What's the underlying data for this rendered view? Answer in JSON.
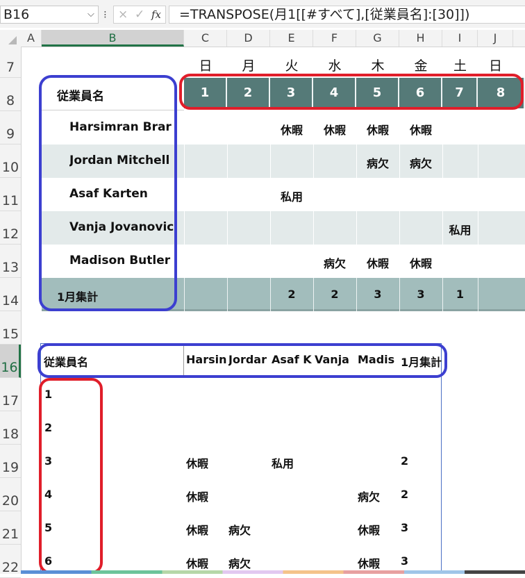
{
  "formula_bar": {
    "cell_ref": "B16",
    "formula": "=TRANSPOSE(月1[[#すべて],[従業員名]:[30]])",
    "fx_label": "fx",
    "cancel_icon": "×",
    "enter_icon": "✓"
  },
  "columns": [
    "A",
    "B",
    "C",
    "D",
    "E",
    "F",
    "G",
    "H",
    "I",
    "J"
  ],
  "rows": [
    "7",
    "8",
    "9",
    "10",
    "11",
    "12",
    "13",
    "14",
    "15",
    "16",
    "17",
    "18",
    "19",
    "20",
    "21",
    "22"
  ],
  "schedule": {
    "weekdays": [
      "日",
      "月",
      "火",
      "水",
      "木",
      "金",
      "土",
      "日"
    ],
    "header_label": "従業員名",
    "days": [
      "1",
      "2",
      "3",
      "4",
      "5",
      "6",
      "7",
      "8"
    ],
    "employees": [
      {
        "name": "Harsimran Brar",
        "marks": [
          "",
          "",
          "休暇",
          "休暇",
          "休暇",
          "休暇",
          "",
          ""
        ]
      },
      {
        "name": "Jordan Mitchell",
        "marks": [
          "",
          "",
          "",
          "",
          "病欠",
          "病欠",
          "",
          ""
        ]
      },
      {
        "name": "Asaf Karten",
        "marks": [
          "",
          "",
          "私用",
          "",
          "",
          "",
          "",
          ""
        ]
      },
      {
        "name": "Vanja Jovanovic",
        "marks": [
          "",
          "",
          "",
          "",
          "",
          "",
          "私用",
          ""
        ]
      },
      {
        "name": "Madison Butler",
        "marks": [
          "",
          "",
          "",
          "病欠",
          "休暇",
          "休暇",
          "",
          ""
        ]
      }
    ],
    "total_label": "1月集計",
    "totals": [
      "",
      "",
      "2",
      "2",
      "3",
      "3",
      "1",
      ""
    ]
  },
  "transposed": {
    "headers": [
      "従業員名",
      "Harsin",
      "Jordar",
      "Asaf K",
      "Vanja",
      "Madis",
      "1月集計"
    ],
    "rows": [
      {
        "day": "1",
        "cells": [
          "",
          "",
          "",
          "",
          "",
          ""
        ]
      },
      {
        "day": "2",
        "cells": [
          "",
          "",
          "",
          "",
          "",
          ""
        ]
      },
      {
        "day": "3",
        "cells": [
          "休暇",
          "",
          "私用",
          "",
          "",
          "2"
        ]
      },
      {
        "day": "4",
        "cells": [
          "休暇",
          "",
          "",
          "",
          "病欠",
          "2"
        ]
      },
      {
        "day": "5",
        "cells": [
          "休暇",
          "病欠",
          "",
          "",
          "休暇",
          "3"
        ]
      },
      {
        "day": "6",
        "cells": [
          "休暇",
          "病欠",
          "",
          "",
          "休暇",
          "3"
        ]
      }
    ]
  },
  "colors": {
    "header_fill": "#557a78",
    "band_fill": "#e3eaea",
    "total_fill": "#a2bdbc",
    "annotation_blue": "#3c3fd0",
    "annotation_red": "#e01e2a",
    "excel_green": "#217346"
  }
}
